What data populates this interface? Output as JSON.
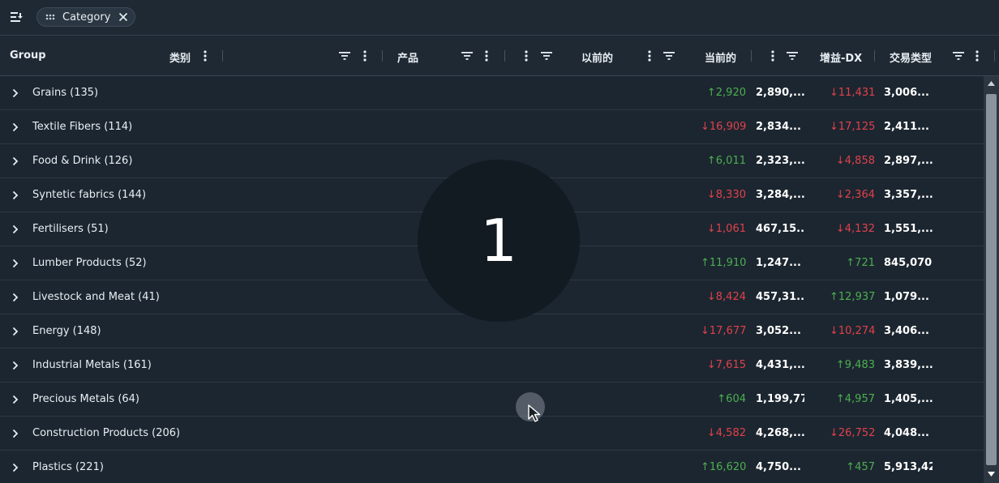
{
  "group_panel": {
    "chip_label": "Category"
  },
  "header": {
    "group": "Group",
    "leibie": "类别",
    "chanpin": "产品",
    "yiqiande": "以前的",
    "dangqiande": "当前的",
    "zengyi": "增益-DX",
    "jiaoyi": "交易类型"
  },
  "rows": [
    {
      "name": "Grains (135)",
      "d1": "↑2,920",
      "d1_dir": "up",
      "v1": "2,890,...",
      "d2": "↓11,431",
      "d2_dir": "down",
      "v2": "3,006..."
    },
    {
      "name": "Textile Fibers (114)",
      "d1": "↓16,909",
      "d1_dir": "down",
      "v1": "2,834...",
      "d2": "↓17,125",
      "d2_dir": "down",
      "v2": "2,411..."
    },
    {
      "name": "Food & Drink (126)",
      "d1": "↑6,011",
      "d1_dir": "up",
      "v1": "2,323,...",
      "d2": "↓4,858",
      "d2_dir": "down",
      "v2": "2,897,..."
    },
    {
      "name": "Syntetic fabrics (144)",
      "d1": "↓8,330",
      "d1_dir": "down",
      "v1": "3,284,...",
      "d2": "↓2,364",
      "d2_dir": "down",
      "v2": "3,357,..."
    },
    {
      "name": "Fertilisers (51)",
      "d1": "↓1,061",
      "d1_dir": "down",
      "v1": "467,15...",
      "d2": "↓4,132",
      "d2_dir": "down",
      "v2": "1,551,..."
    },
    {
      "name": "Lumber Products (52)",
      "d1": "↑11,910",
      "d1_dir": "up",
      "v1": "1,247...",
      "d2": "↑721",
      "d2_dir": "up",
      "v2": "845,070"
    },
    {
      "name": "Livestock and Meat (41)",
      "d1": "↓8,424",
      "d1_dir": "down",
      "v1": "457,31...",
      "d2": "↑12,937",
      "d2_dir": "up",
      "v2": "1,079..."
    },
    {
      "name": "Energy (148)",
      "d1": "↓17,677",
      "d1_dir": "down",
      "v1": "3,052...",
      "d2": "↓10,274",
      "d2_dir": "down",
      "v2": "3,406..."
    },
    {
      "name": "Industrial Metals (161)",
      "d1": "↓7,615",
      "d1_dir": "down",
      "v1": "4,431,...",
      "d2": "↑9,483",
      "d2_dir": "up",
      "v2": "3,839,..."
    },
    {
      "name": "Precious Metals (64)",
      "d1": "↑604",
      "d1_dir": "up",
      "v1": "1,199,77...",
      "d2": "↑4,957",
      "d2_dir": "up",
      "v2": "1,405,..."
    },
    {
      "name": "Construction Products (206)",
      "d1": "↓4,582",
      "d1_dir": "down",
      "v1": "4,268,...",
      "d2": "↓26,752",
      "d2_dir": "down",
      "v2": "4,048..."
    },
    {
      "name": "Plastics (221)",
      "d1": "↑16,620",
      "d1_dir": "up",
      "v1": "4,750...",
      "d2": "↑457",
      "d2_dir": "up",
      "v2": "5,913,42..."
    }
  ],
  "overlay": {
    "counter": "1"
  },
  "colors": {
    "up": "#4caf50",
    "down": "#e0414b",
    "background": "#1c2630"
  }
}
